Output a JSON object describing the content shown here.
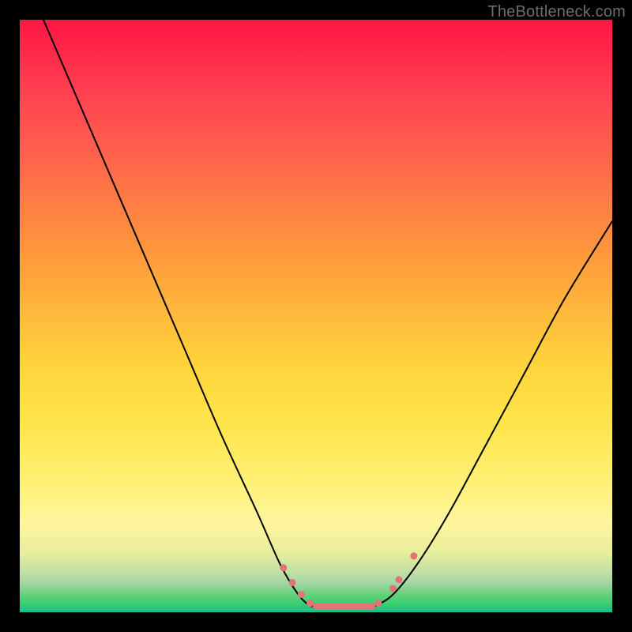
{
  "watermark": "TheBottleneck.com",
  "chart_data": {
    "type": "line",
    "title": "",
    "xlabel": "",
    "ylabel": "",
    "xlim": [
      0,
      100
    ],
    "ylim": [
      0,
      100
    ],
    "grid": false,
    "legend": false,
    "series": [
      {
        "name": "left-curve",
        "x": [
          4,
          10,
          16,
          22,
          28,
          34,
          40,
          44,
          47,
          49
        ],
        "y": [
          100,
          86,
          72,
          58,
          44,
          30,
          17,
          8,
          3,
          1
        ]
      },
      {
        "name": "right-curve",
        "x": [
          60,
          63,
          67,
          72,
          78,
          85,
          92,
          100
        ],
        "y": [
          1,
          3,
          8,
          16,
          27,
          40,
          53,
          66
        ]
      },
      {
        "name": "valley-floor",
        "x": [
          49,
          60
        ],
        "y": [
          1,
          1
        ]
      }
    ],
    "markers": {
      "name": "beads",
      "color": "#e57373",
      "points": [
        {
          "x": 44.5,
          "y": 7.5
        },
        {
          "x": 46.0,
          "y": 5.0
        },
        {
          "x": 47.5,
          "y": 3.0
        },
        {
          "x": 49.0,
          "y": 1.5
        },
        {
          "x": 60.5,
          "y": 1.5
        },
        {
          "x": 63.0,
          "y": 4.0
        },
        {
          "x": 64.0,
          "y": 5.5
        },
        {
          "x": 66.5,
          "y": 9.5
        }
      ],
      "segment": {
        "x0": 50,
        "x1": 59.5,
        "y": 1
      }
    },
    "background_gradient": {
      "top": "#ff1744",
      "mid": "#ffd43b",
      "bottom": "#1abc9c"
    }
  }
}
